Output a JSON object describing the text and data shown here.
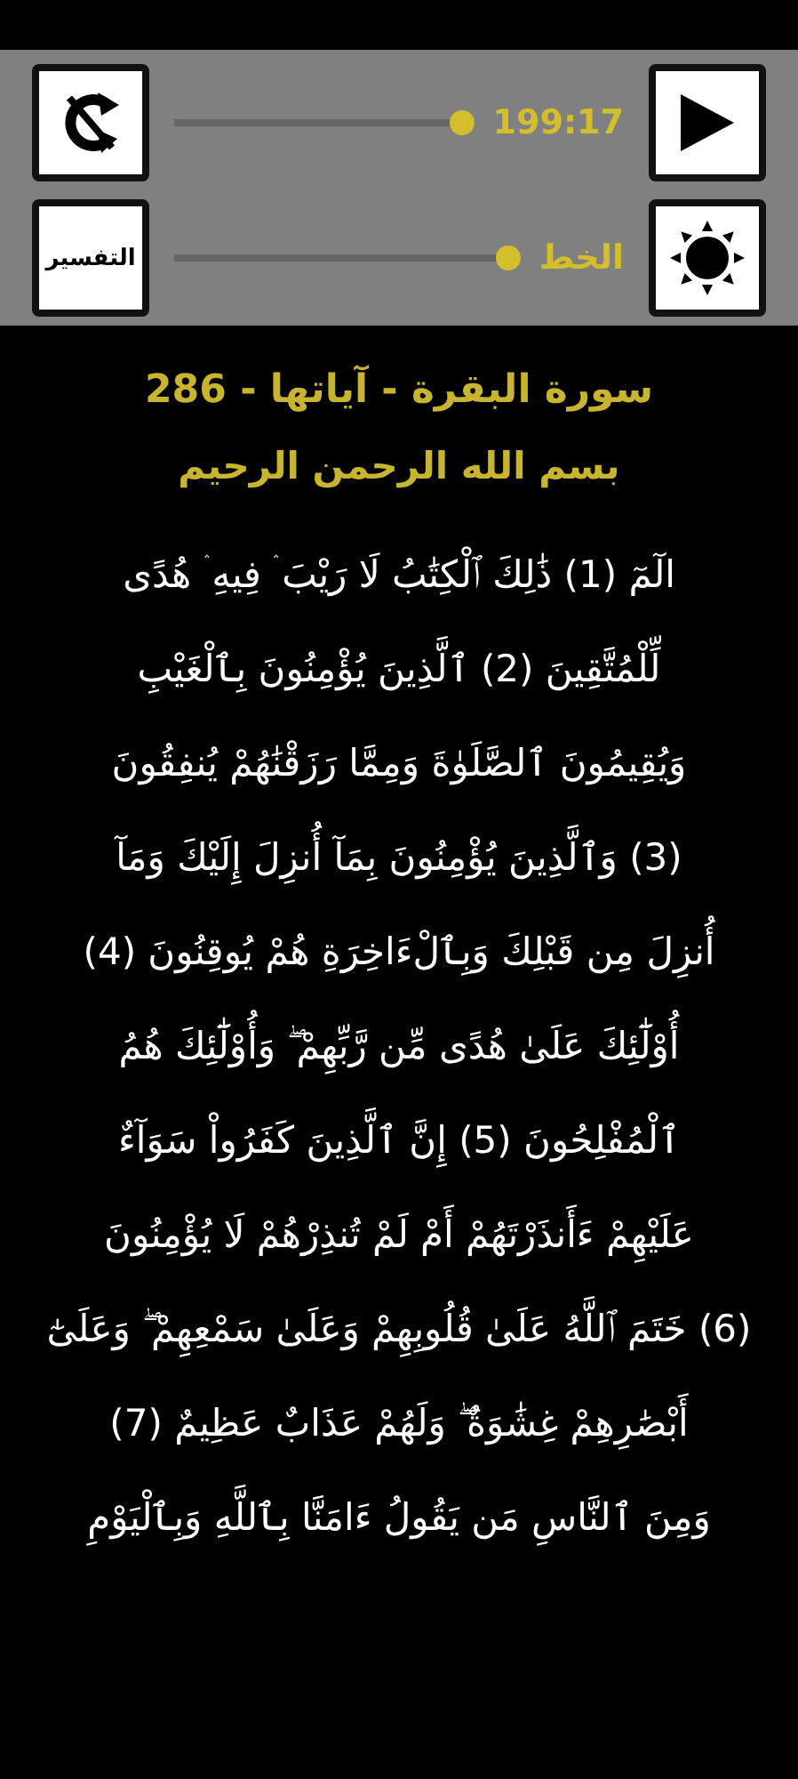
{
  "controls": {
    "audio": {
      "time": "199:17",
      "level": 1
    },
    "font": {
      "label": "الخط",
      "level": 1
    },
    "tafsir_button": "التفسير"
  },
  "header": {
    "title": "سورة البقرة - آياتها - 286",
    "basmala": "بسم الله الرحمن الرحيم"
  },
  "verse_lines": [
    "الٓمٓ (1) ذَٰلِكَ ٱلْكِتَٰبُ لَا رَيْبَ ۛ فِيهِ ۛ هُدًى",
    "لِّلْمُتَّقِينَ (2) ٱلَّذِينَ يُؤْمِنُونَ بِٱلْغَيْبِ",
    "وَيُقِيمُونَ ٱلصَّلَوٰةَ وَمِمَّا رَزَقْنَٰهُمْ يُنفِقُونَ",
    "(3) وَٱلَّذِينَ يُؤْمِنُونَ بِمَآ أُنزِلَ إِلَيْكَ وَمَآ",
    "أُنزِلَ مِن قَبْلِكَ وَبِٱلْءَاخِرَةِ هُمْ يُوقِنُونَ (4)",
    "أُوْلَٰٓئِكَ عَلَىٰ هُدًى مِّن رَّبِّهِمْ ۖ وَأُوْلَٰٓئِكَ هُمُ",
    "ٱلْمُفْلِحُونَ (5) إِنَّ ٱلَّذِينَ كَفَرُواْ سَوَآءٌ",
    "عَلَيْهِمْ ءَأَنذَرْتَهُمْ أَمْ لَمْ تُنذِرْهُمْ لَا يُؤْمِنُونَ",
    "(6) خَتَمَ ٱللَّهُ عَلَىٰ قُلُوبِهِمْ وَعَلَىٰ سَمْعِهِمْ ۖ وَعَلَىٰٓ",
    "أَبْصَٰرِهِمْ غِشَٰوَةٌ ۖ وَلَهُمْ عَذَابٌ عَظِيمٌ (7)",
    "وَمِنَ ٱلنَّاسِ مَن يَقُولُ ءَامَنَّا بِٱللَّهِ وَبِٱلْيَوْمِ"
  ]
}
